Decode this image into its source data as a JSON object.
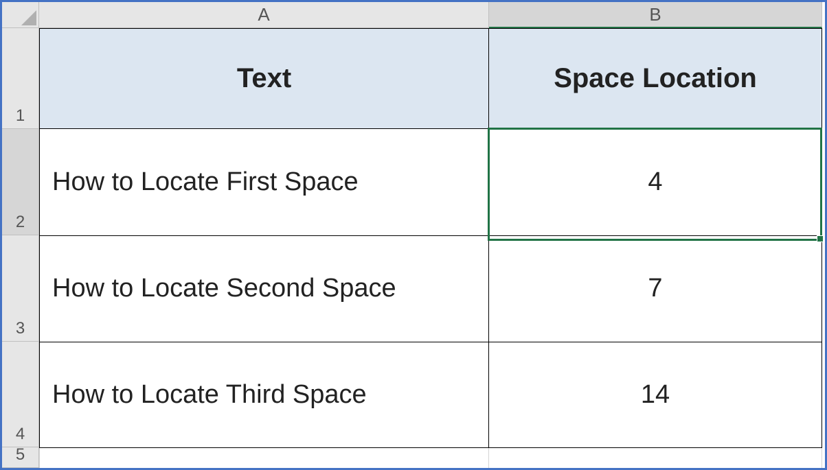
{
  "columns": {
    "a": "A",
    "b": "B"
  },
  "rows": {
    "r1": "1",
    "r2": "2",
    "r3": "3",
    "r4": "4",
    "r5": "5"
  },
  "headers": {
    "text": "Text",
    "space_location": "Space Location"
  },
  "data": [
    {
      "text": "How to Locate First Space",
      "value": "4"
    },
    {
      "text": "How to Locate Second Space",
      "value": "7"
    },
    {
      "text": "How to Locate Third Space",
      "value": "14"
    }
  ]
}
